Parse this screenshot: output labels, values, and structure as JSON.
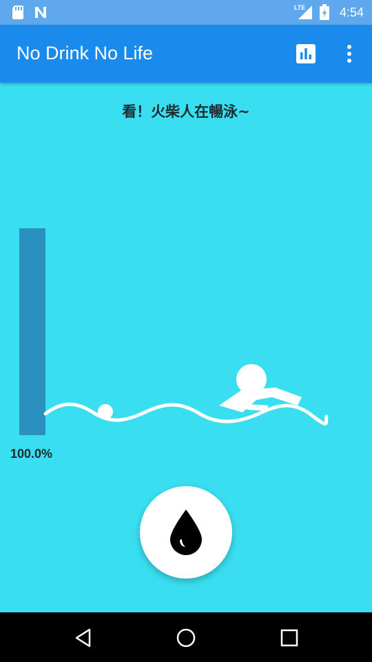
{
  "status_bar": {
    "time": "4:54",
    "network": "LTE",
    "icons": [
      "sd-card-icon",
      "n-app-icon",
      "lte-signal-icon",
      "battery-charging-icon"
    ]
  },
  "app_bar": {
    "title": "No Drink No Life",
    "actions": [
      "bar-chart-icon",
      "overflow-menu-icon"
    ]
  },
  "main": {
    "headline": "看！火柴人在暢泳~",
    "water_level_fraction": 1.0,
    "percent_label": "100.0%",
    "drink_button_icon": "water-drop-icon"
  },
  "nav_bar": {
    "buttons": [
      "back-icon",
      "home-icon",
      "recents-icon"
    ]
  },
  "colors": {
    "background": "#39dff0",
    "status_bar": "#5fa8ee",
    "app_bar": "#1a8bed",
    "water_bar": "#2a90c0"
  }
}
